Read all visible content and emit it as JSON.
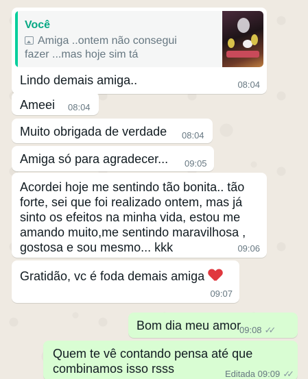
{
  "reply": {
    "author": "Você",
    "quoted_line1": "Amiga ..ontem não consegui",
    "quoted_line2": "fazer ...mas hoje sim tá",
    "quoted_icon": "image-icon",
    "message": "Lindo demais amiga..",
    "time": "08:04"
  },
  "messages": [
    {
      "text": "Ameei",
      "time": "08:04"
    },
    {
      "text": "Muito obrigada de verdade",
      "time": "08:04"
    },
    {
      "text": "Amiga só para agradecer...",
      "time": "09:05"
    },
    {
      "lines": [
        "Acordei hoje me sentindo tão bonita.. tão",
        "forte, sei que foi realizado ontem, mas já",
        "sinto os efeitos na minha vida, estou me",
        "amando muito,me sentindo maravilhosa ,",
        "gostosa e sou mesmo... kkk"
      ],
      "time": "09:06"
    },
    {
      "text": "Gratidão, vc é foda demais amiga",
      "emoji": "red-heart",
      "time": "09:07"
    }
  ],
  "outgoing": [
    {
      "text": "Bom dia meu amor",
      "time": "09:08",
      "status": "read-ticks"
    },
    {
      "line1": "Quem te vê contando pensa até que",
      "line2": "combinamos isso rsss",
      "edited": "Editada",
      "time": "09:09",
      "status": "read-ticks"
    }
  ],
  "colors": {
    "incoming": "#ffffff",
    "outgoing": "#d9fdd3",
    "quote_accent": "#06cf9c",
    "background": "#efeae2"
  }
}
